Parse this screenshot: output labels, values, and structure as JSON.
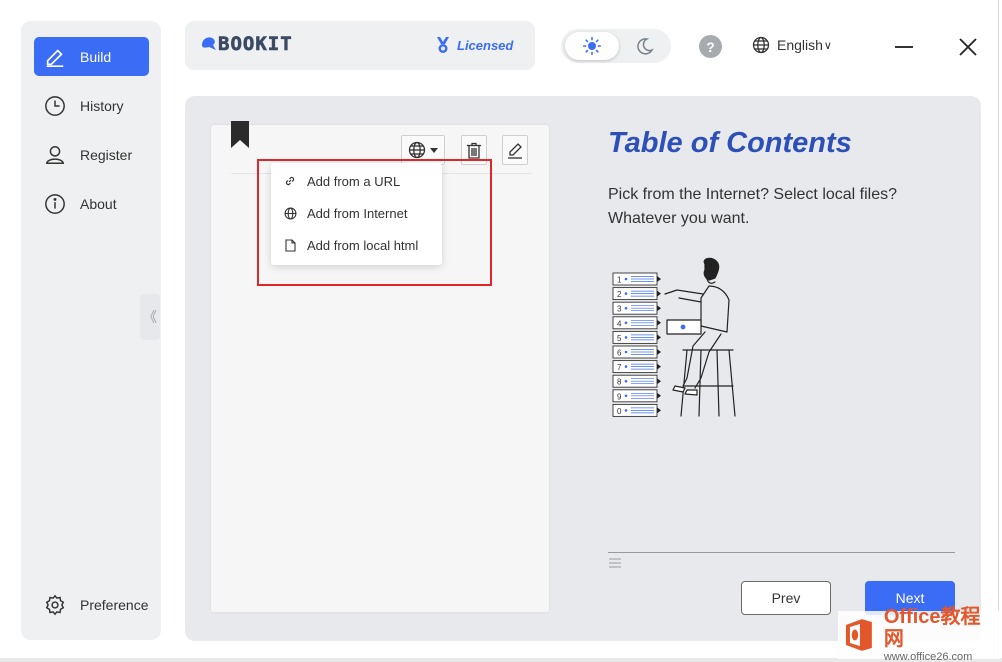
{
  "sidebar": {
    "items": [
      {
        "label": "Build",
        "icon": "pencil-icon",
        "active": true
      },
      {
        "label": "History",
        "icon": "clock-icon"
      },
      {
        "label": "Register",
        "icon": "user-icon"
      },
      {
        "label": "About",
        "icon": "info-icon"
      }
    ],
    "preference": {
      "label": "Preference",
      "icon": "gear-icon"
    },
    "collapse_glyph": "《"
  },
  "header": {
    "logo_text": "BOOKIT",
    "license_label": "Licensed",
    "theme": {
      "selected": "light"
    },
    "help_glyph": "?",
    "language": "English",
    "language_caret": "∨"
  },
  "card": {
    "dropdown": {
      "items": [
        {
          "label": "Add from a URL",
          "icon": "link-icon"
        },
        {
          "label": "Add from Internet",
          "icon": "globe-icon"
        },
        {
          "label": "Add from local html",
          "icon": "file-icon"
        }
      ]
    }
  },
  "content": {
    "title": "Table of Contents",
    "description": "Pick from the Internet? Select local files? Whatever you want.",
    "illustration_numbers": [
      "1",
      "2",
      "3",
      "4",
      "5",
      "6",
      "7",
      "8",
      "9",
      "0"
    ]
  },
  "footer": {
    "prev_label": "Prev",
    "next_label": "Next"
  },
  "watermark": {
    "main": "Office教程网",
    "sub": "www.office26.com"
  },
  "colors": {
    "accent": "#3b6cf6",
    "title": "#2d4fb8",
    "highlight": "#e0262a",
    "watermark": "#e2572b"
  }
}
